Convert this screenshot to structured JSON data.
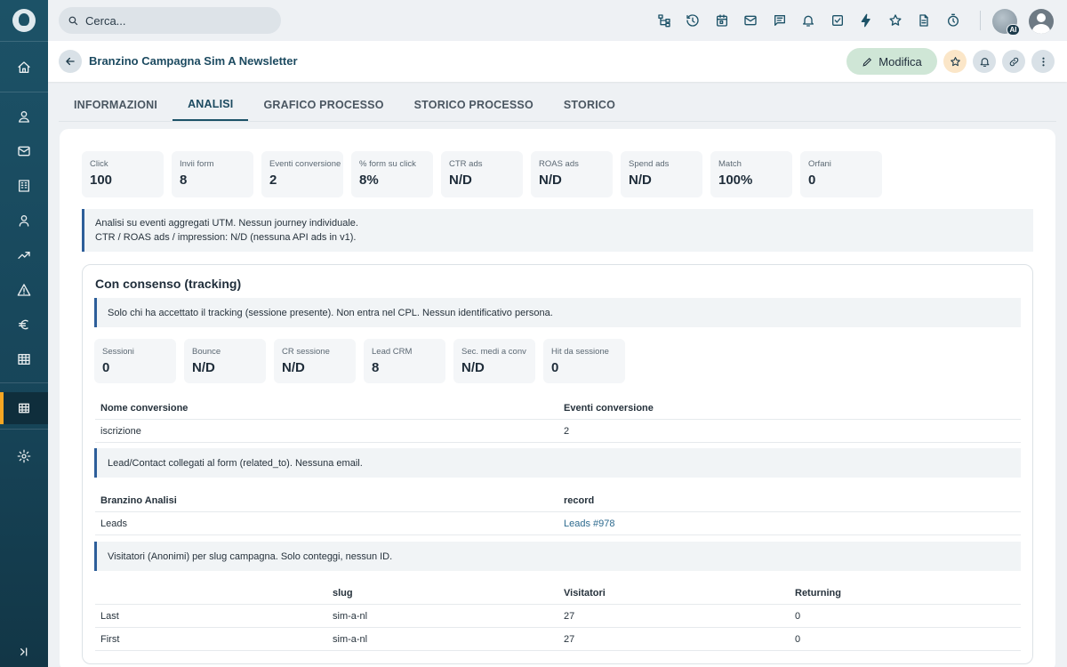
{
  "search": {
    "placeholder": "Cerca..."
  },
  "topbar": {
    "icons": [
      "sitemap-icon",
      "history-icon",
      "calendar-icon",
      "mail-icon",
      "chat-icon",
      "bell-icon",
      "task-icon",
      "bolt-icon",
      "star-icon",
      "document-icon",
      "timer-icon"
    ],
    "ai_badge": "AI"
  },
  "sidebar": {
    "items": [
      "home-icon",
      "user-icon",
      "mail-icon",
      "building-icon",
      "contact-icon",
      "trend-icon",
      "warning-icon",
      "euro-icon",
      "table-icon",
      "grid-icon",
      "settings-icon",
      "collapse-icon"
    ],
    "active": "grid-icon",
    "accent": "#f5a623"
  },
  "header": {
    "title": "Branzino Campagna Sim A Newsletter",
    "edit_label": "Modifica"
  },
  "tabs": [
    {
      "label": "INFORMAZIONI"
    },
    {
      "label": "ANALISI"
    },
    {
      "label": "GRAFICO PROCESSO"
    },
    {
      "label": "STORICO PROCESSO"
    },
    {
      "label": "STORICO"
    }
  ],
  "active_tab": "ANALISI",
  "kpis": [
    {
      "label": "Click",
      "value": "100"
    },
    {
      "label": "Invii form",
      "value": "8"
    },
    {
      "label": "Eventi conversione",
      "value": "2"
    },
    {
      "label": "% form su click",
      "value": "8%"
    },
    {
      "label": "CTR ads",
      "value": "N/D"
    },
    {
      "label": "ROAS ads",
      "value": "N/D"
    },
    {
      "label": "Spend ads",
      "value": "N/D"
    },
    {
      "label": "Match",
      "value": "100%"
    },
    {
      "label": "Orfani",
      "value": "0"
    }
  ],
  "note_main": {
    "line1": "Analisi su eventi aggregati UTM. Nessun journey individuale.",
    "line2": "CTR / ROAS ads / impression: N/D (nessuna API ads in v1)."
  },
  "consent": {
    "title": "Con consenso (tracking)",
    "note": "Solo chi ha accettato il tracking (sessione presente). Non entra nel CPL. Nessun identificativo persona.",
    "kpis": [
      {
        "label": "Sessioni",
        "value": "0"
      },
      {
        "label": "Bounce",
        "value": "N/D"
      },
      {
        "label": "CR sessione",
        "value": "N/D"
      },
      {
        "label": "Lead CRM",
        "value": "8"
      },
      {
        "label": "Sec. medi a conv",
        "value": "N/D"
      },
      {
        "label": "Hit da sessione",
        "value": "0"
      }
    ],
    "conversions": {
      "headers": [
        "Nome conversione",
        "Eventi conversione"
      ],
      "rows": [
        [
          "iscrizione",
          "2"
        ]
      ]
    },
    "lead_note": "Lead/Contact collegati al form (related_to). Nessuna email.",
    "analysis": {
      "headers": [
        "Branzino Analisi",
        "record"
      ],
      "rows": [
        [
          "Leads",
          "Leads #978"
        ]
      ]
    },
    "visitor_note": "Visitatori (Anonimi) per slug campagna. Solo conteggi, nessun ID.",
    "visitors": {
      "headers": [
        "",
        "slug",
        "Visitatori",
        "Returning"
      ],
      "rows": [
        [
          "Last",
          "sim-a-nl",
          "27",
          "0"
        ],
        [
          "First",
          "sim-a-nl",
          "27",
          "0"
        ]
      ]
    }
  }
}
